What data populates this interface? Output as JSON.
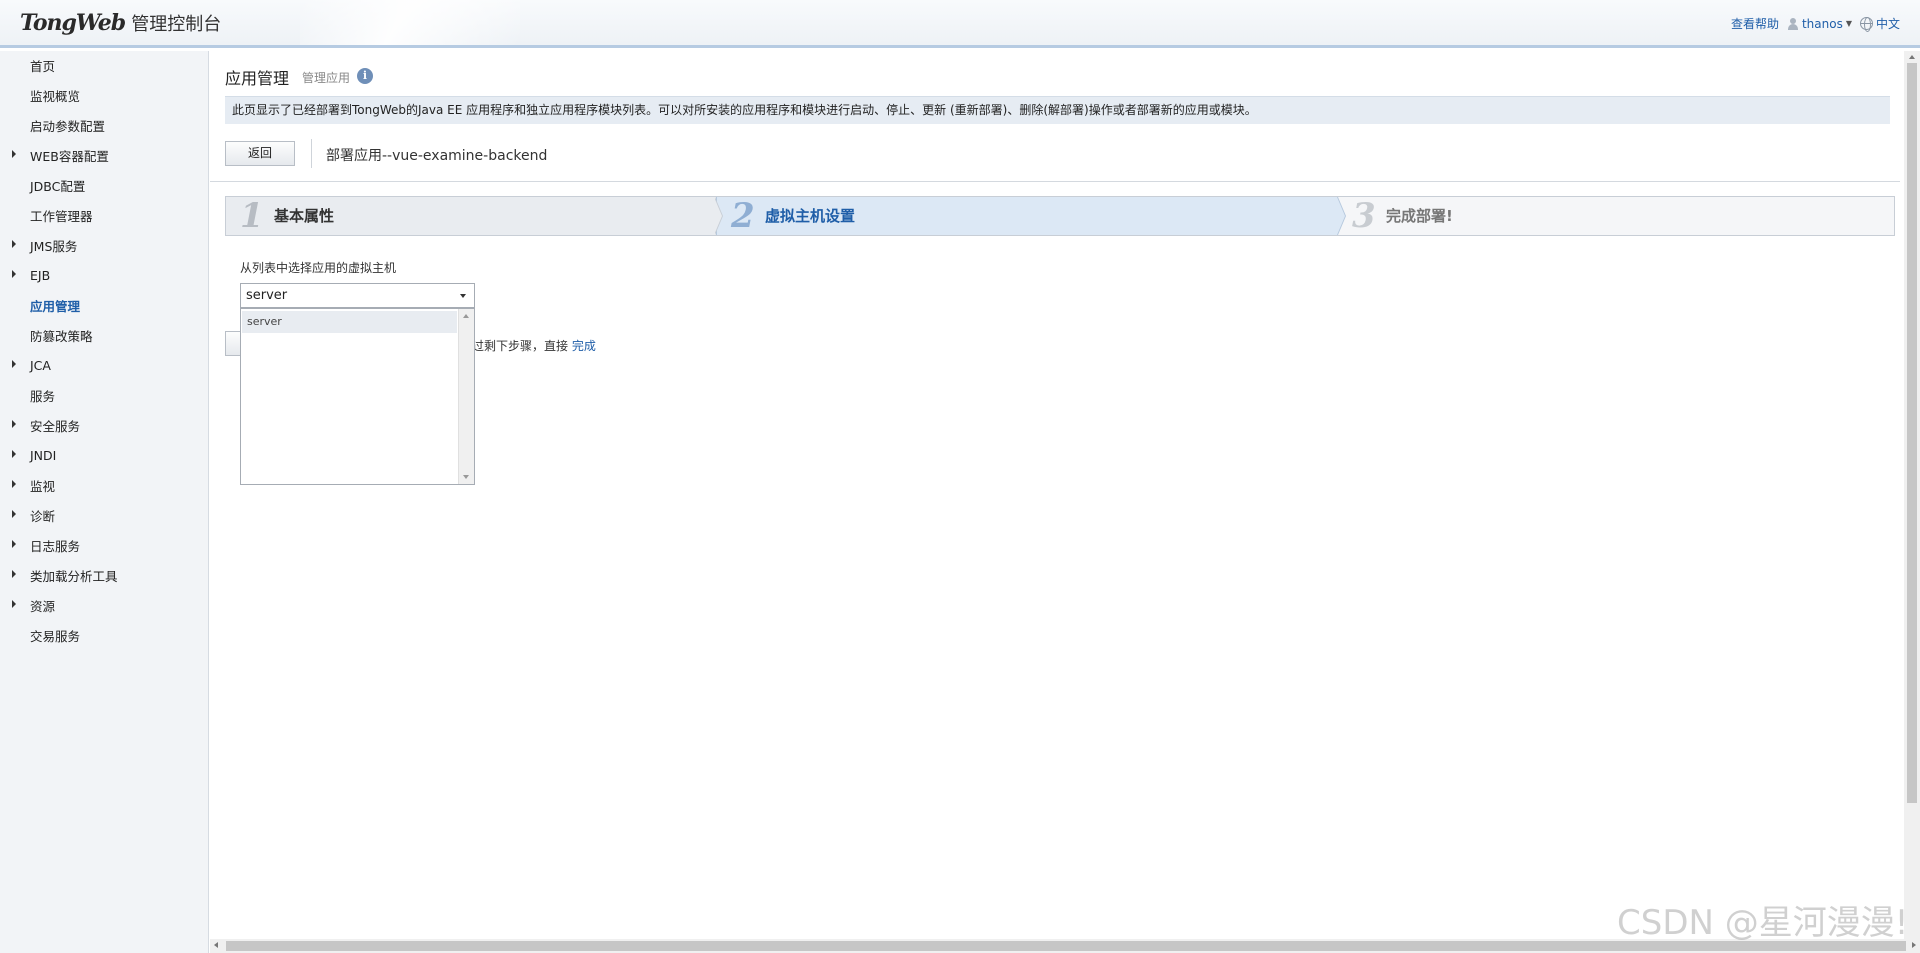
{
  "header": {
    "brand": "TongWeb",
    "console": "管理控制台",
    "help": "查看帮助",
    "user": "thanos",
    "lang": "中文"
  },
  "sidebar": {
    "items": [
      {
        "label": "首页",
        "expandable": false,
        "active": false
      },
      {
        "label": "监视概览",
        "expandable": false,
        "active": false
      },
      {
        "label": "启动参数配置",
        "expandable": false,
        "active": false
      },
      {
        "label": "WEB容器配置",
        "expandable": true,
        "active": false
      },
      {
        "label": "JDBC配置",
        "expandable": false,
        "active": false
      },
      {
        "label": "工作管理器",
        "expandable": false,
        "active": false
      },
      {
        "label": "JMS服务",
        "expandable": true,
        "active": false
      },
      {
        "label": "EJB",
        "expandable": true,
        "active": false
      },
      {
        "label": "应用管理",
        "expandable": false,
        "active": true
      },
      {
        "label": "防篡改策略",
        "expandable": false,
        "active": false
      },
      {
        "label": "JCA",
        "expandable": true,
        "active": false
      },
      {
        "label": "服务",
        "expandable": false,
        "active": false
      },
      {
        "label": "安全服务",
        "expandable": true,
        "active": false
      },
      {
        "label": "JNDI",
        "expandable": true,
        "active": false
      },
      {
        "label": "监视",
        "expandable": true,
        "active": false
      },
      {
        "label": "诊断",
        "expandable": true,
        "active": false
      },
      {
        "label": "日志服务",
        "expandable": true,
        "active": false
      },
      {
        "label": "类加载分析工具",
        "expandable": true,
        "active": false
      },
      {
        "label": "资源",
        "expandable": true,
        "active": false
      },
      {
        "label": "交易服务",
        "expandable": false,
        "active": false
      }
    ]
  },
  "main": {
    "title": "应用管理",
    "subtitle": "管理应用",
    "info_icon": "i",
    "description": "此页显示了已经部署到TongWeb的Java EE 应用程序和独立应用程序模块列表。可以对所安装的应用程序和模块进行启动、停止、更新 (重新部署)、删除(解部署)操作或者部署新的应用或模块。",
    "back_label": "返回",
    "deploy_title": "部署应用--vue-examine-backend",
    "steps": [
      {
        "num": "1",
        "label": "基本属性",
        "state": "done"
      },
      {
        "num": "2",
        "label": "虚拟主机设置",
        "state": "current"
      },
      {
        "num": "3",
        "label": "完成部署!",
        "state": "pending"
      }
    ],
    "vhost": {
      "label": "从列表中选择应用的虚拟主机",
      "selected": "server",
      "options": [
        "server"
      ]
    },
    "skip_text": "跳过剩下步骤，直接",
    "finish_link": "完成"
  },
  "watermark": "CSDN @星河漫漫!"
}
